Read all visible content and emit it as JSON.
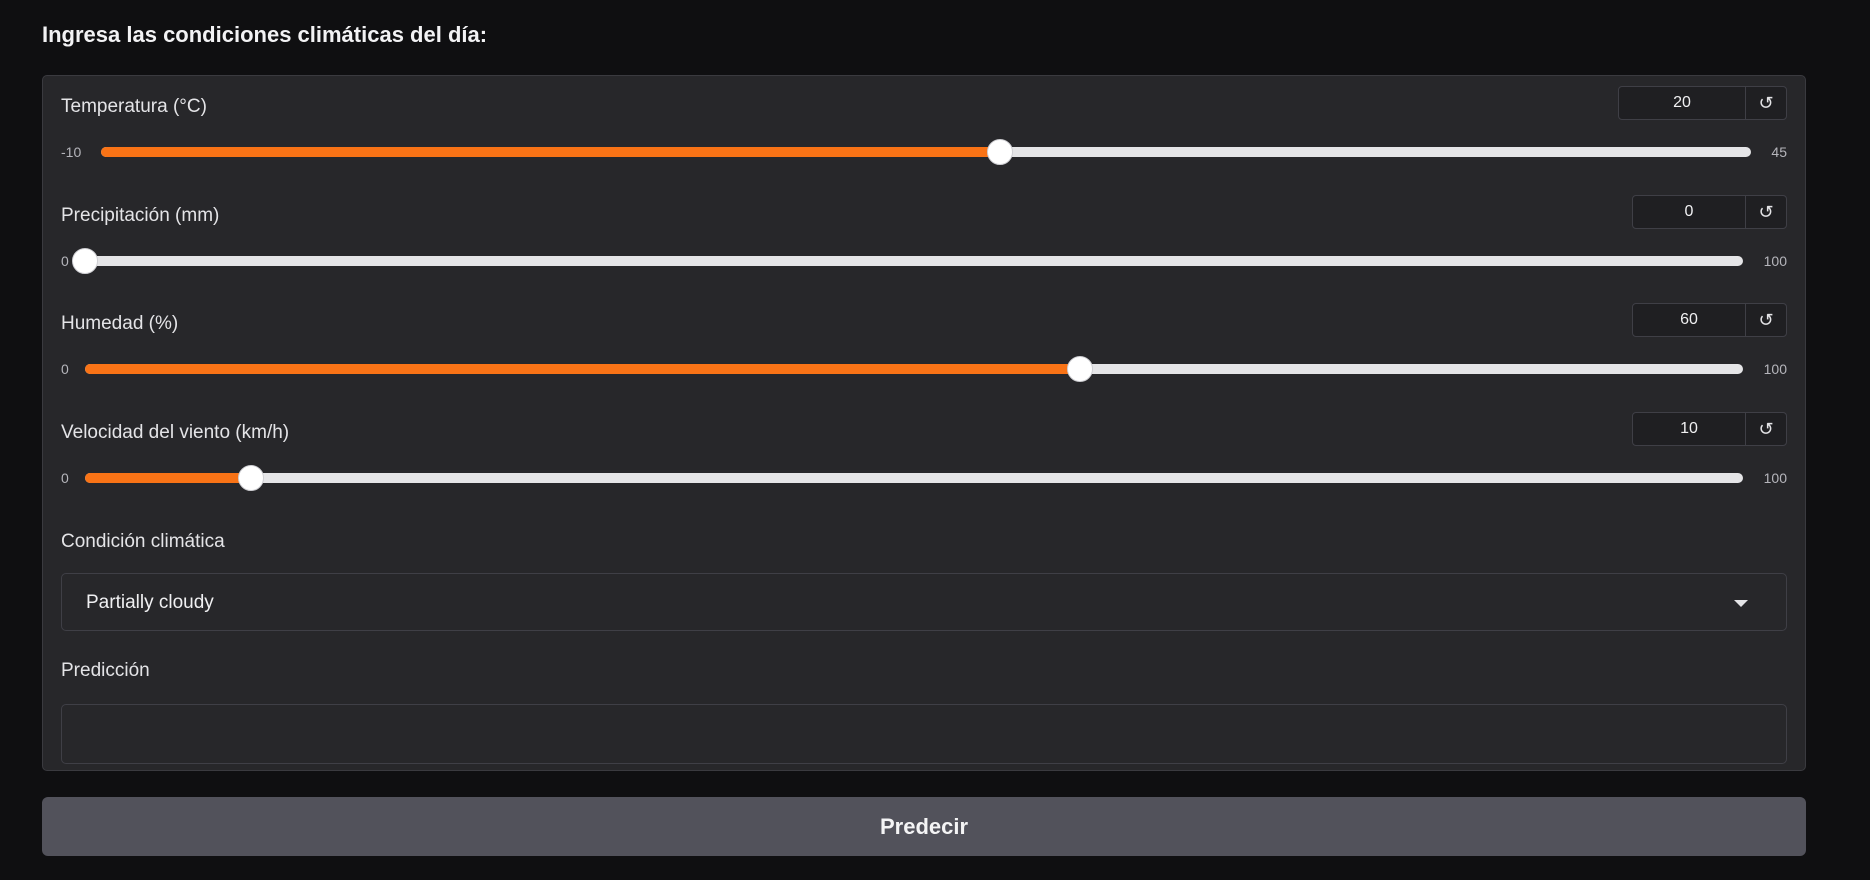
{
  "heading": "Ingresa las condiciones climáticas del día:",
  "sliders": [
    {
      "label": "Temperatura (°C)",
      "value": "20",
      "min": "-10",
      "max": "45",
      "fraction": 0.545
    },
    {
      "label": "Precipitación (mm)",
      "value": "0",
      "min": "0",
      "max": "100",
      "fraction": 0.0
    },
    {
      "label": "Humedad (%)",
      "value": "60",
      "min": "0",
      "max": "100",
      "fraction": 0.6
    },
    {
      "label": "Velocidad del viento (km/h)",
      "value": "10",
      "min": "0",
      "max": "100",
      "fraction": 0.1
    }
  ],
  "reset_glyph": "↺",
  "condition": {
    "label": "Condición climática",
    "selected": "Partially cloudy"
  },
  "prediction": {
    "label": "Predicción",
    "value": ""
  },
  "predict_button": "Predecir",
  "colors": {
    "accent": "#f97316",
    "track": "#e5e5e7",
    "panel": "#27272a",
    "background": "#0f0f11",
    "button": "#52525b"
  },
  "icons": {
    "reset": "reset-icon",
    "dropdown": "caret-down-icon"
  }
}
